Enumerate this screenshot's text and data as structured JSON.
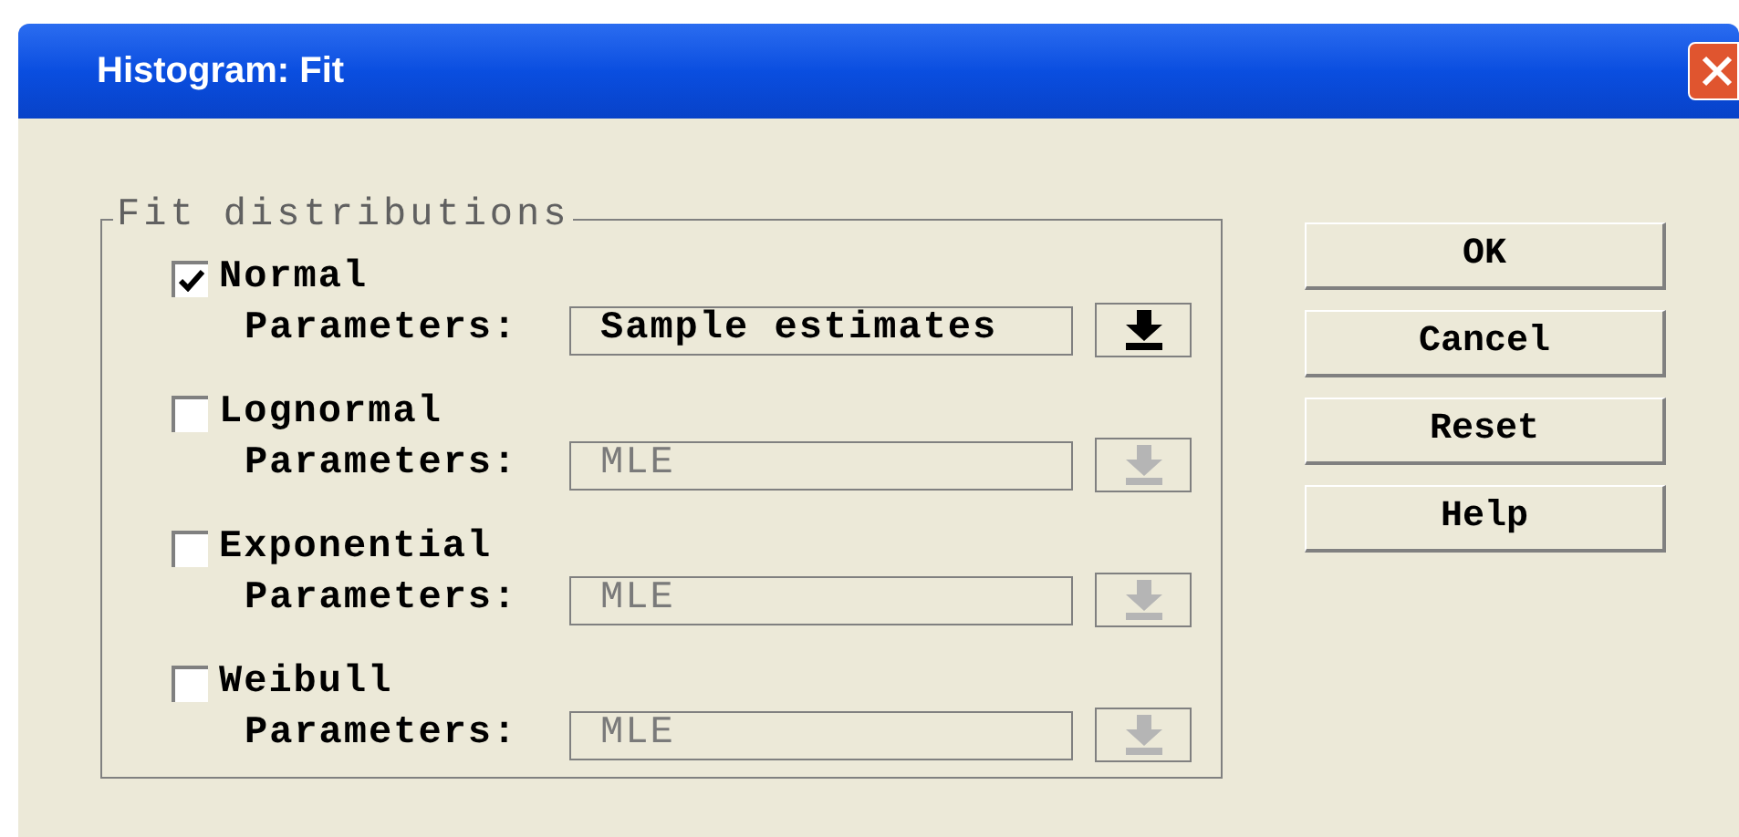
{
  "window": {
    "title": "Histogram: Fit"
  },
  "group": {
    "title": "Fit distributions",
    "distributions": [
      {
        "label": "Normal",
        "checked": true,
        "parameters_label": "Parameters:",
        "value": "Sample estimates",
        "disabled": false
      },
      {
        "label": "Lognormal",
        "checked": false,
        "parameters_label": "Parameters:",
        "value": "MLE",
        "disabled": true
      },
      {
        "label": "Exponential",
        "checked": false,
        "parameters_label": "Parameters:",
        "value": "MLE",
        "disabled": true
      },
      {
        "label": "Weibull",
        "checked": false,
        "parameters_label": "Parameters:",
        "value": "MLE",
        "disabled": true
      }
    ]
  },
  "buttons": [
    "OK",
    "Cancel",
    "Reset",
    "Help"
  ]
}
